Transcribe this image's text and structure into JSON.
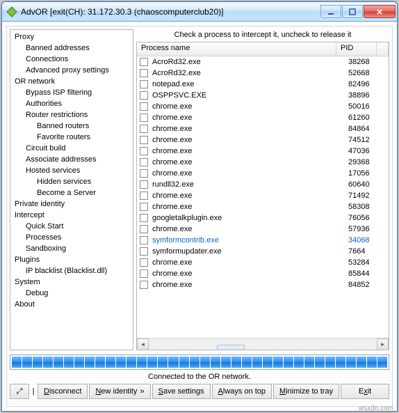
{
  "title": "AdvOR [exit(CH): 31.172.30.3 (chaoscomputerclub20)]",
  "hint": "Check a process to intercept it, uncheck to release it",
  "columns": {
    "name": "Process name",
    "pid": "PID"
  },
  "tree": [
    {
      "label": "Proxy",
      "lvl": 0
    },
    {
      "label": "Banned addresses",
      "lvl": 1
    },
    {
      "label": "Connections",
      "lvl": 1
    },
    {
      "label": "Advanced proxy settings",
      "lvl": 1
    },
    {
      "label": "OR network",
      "lvl": 0
    },
    {
      "label": "Bypass ISP filtering",
      "lvl": 1
    },
    {
      "label": "Authorities",
      "lvl": 1
    },
    {
      "label": "Router restrictions",
      "lvl": 1
    },
    {
      "label": "Banned routers",
      "lvl": 2
    },
    {
      "label": "Favorite routers",
      "lvl": 2
    },
    {
      "label": "Circuit build",
      "lvl": 1
    },
    {
      "label": "Associate addresses",
      "lvl": 1
    },
    {
      "label": "Hosted services",
      "lvl": 1
    },
    {
      "label": "Hidden services",
      "lvl": 2
    },
    {
      "label": "Become a Server",
      "lvl": 2
    },
    {
      "label": "Private identity",
      "lvl": 0
    },
    {
      "label": "Intercept",
      "lvl": 0
    },
    {
      "label": "Quick Start",
      "lvl": 1
    },
    {
      "label": "Processes",
      "lvl": 1
    },
    {
      "label": "Sandboxing",
      "lvl": 1
    },
    {
      "label": "Plugins",
      "lvl": 0
    },
    {
      "label": "IP blacklist (Blacklist.dll)",
      "lvl": 1
    },
    {
      "label": "System",
      "lvl": 0
    },
    {
      "label": "Debug",
      "lvl": 1
    },
    {
      "label": "About",
      "lvl": 0
    }
  ],
  "processes": [
    {
      "name": "AcroRd32.exe",
      "pid": "38268",
      "hl": false
    },
    {
      "name": "AcroRd32.exe",
      "pid": "52668",
      "hl": false
    },
    {
      "name": "notepad.exe",
      "pid": "82496",
      "hl": false
    },
    {
      "name": "OSPPSVC.EXE",
      "pid": "38896",
      "hl": false
    },
    {
      "name": "chrome.exe",
      "pid": "50016",
      "hl": false
    },
    {
      "name": "chrome.exe",
      "pid": "61260",
      "hl": false
    },
    {
      "name": "chrome.exe",
      "pid": "84864",
      "hl": false
    },
    {
      "name": "chrome.exe",
      "pid": "74512",
      "hl": false
    },
    {
      "name": "chrome.exe",
      "pid": "47036",
      "hl": false
    },
    {
      "name": "chrome.exe",
      "pid": "29368",
      "hl": false
    },
    {
      "name": "chrome.exe",
      "pid": "17056",
      "hl": false
    },
    {
      "name": "rundll32.exe",
      "pid": "60640",
      "hl": false
    },
    {
      "name": "chrome.exe",
      "pid": "71492",
      "hl": false
    },
    {
      "name": "chrome.exe",
      "pid": "58308",
      "hl": false
    },
    {
      "name": "googletalkplugin.exe",
      "pid": "76056",
      "hl": false
    },
    {
      "name": "chrome.exe",
      "pid": "57936",
      "hl": false
    },
    {
      "name": "symformcontrib.exe",
      "pid": "34068",
      "hl": true
    },
    {
      "name": "symformupdater.exe",
      "pid": "7664",
      "hl": false
    },
    {
      "name": "chrome.exe",
      "pid": "53284",
      "hl": false
    },
    {
      "name": "chrome.exe",
      "pid": "85844",
      "hl": false
    },
    {
      "name": "chrome.exe",
      "pid": "84852",
      "hl": false
    }
  ],
  "status": "Connected to the OR network.",
  "buttons": {
    "disconnect": "Disconnect",
    "newid": "New identity",
    "save": "Save settings",
    "ontop": "Always on top",
    "minimize": "Minimize to tray",
    "exit": "Exit"
  },
  "watermark": "wsxdn.com"
}
